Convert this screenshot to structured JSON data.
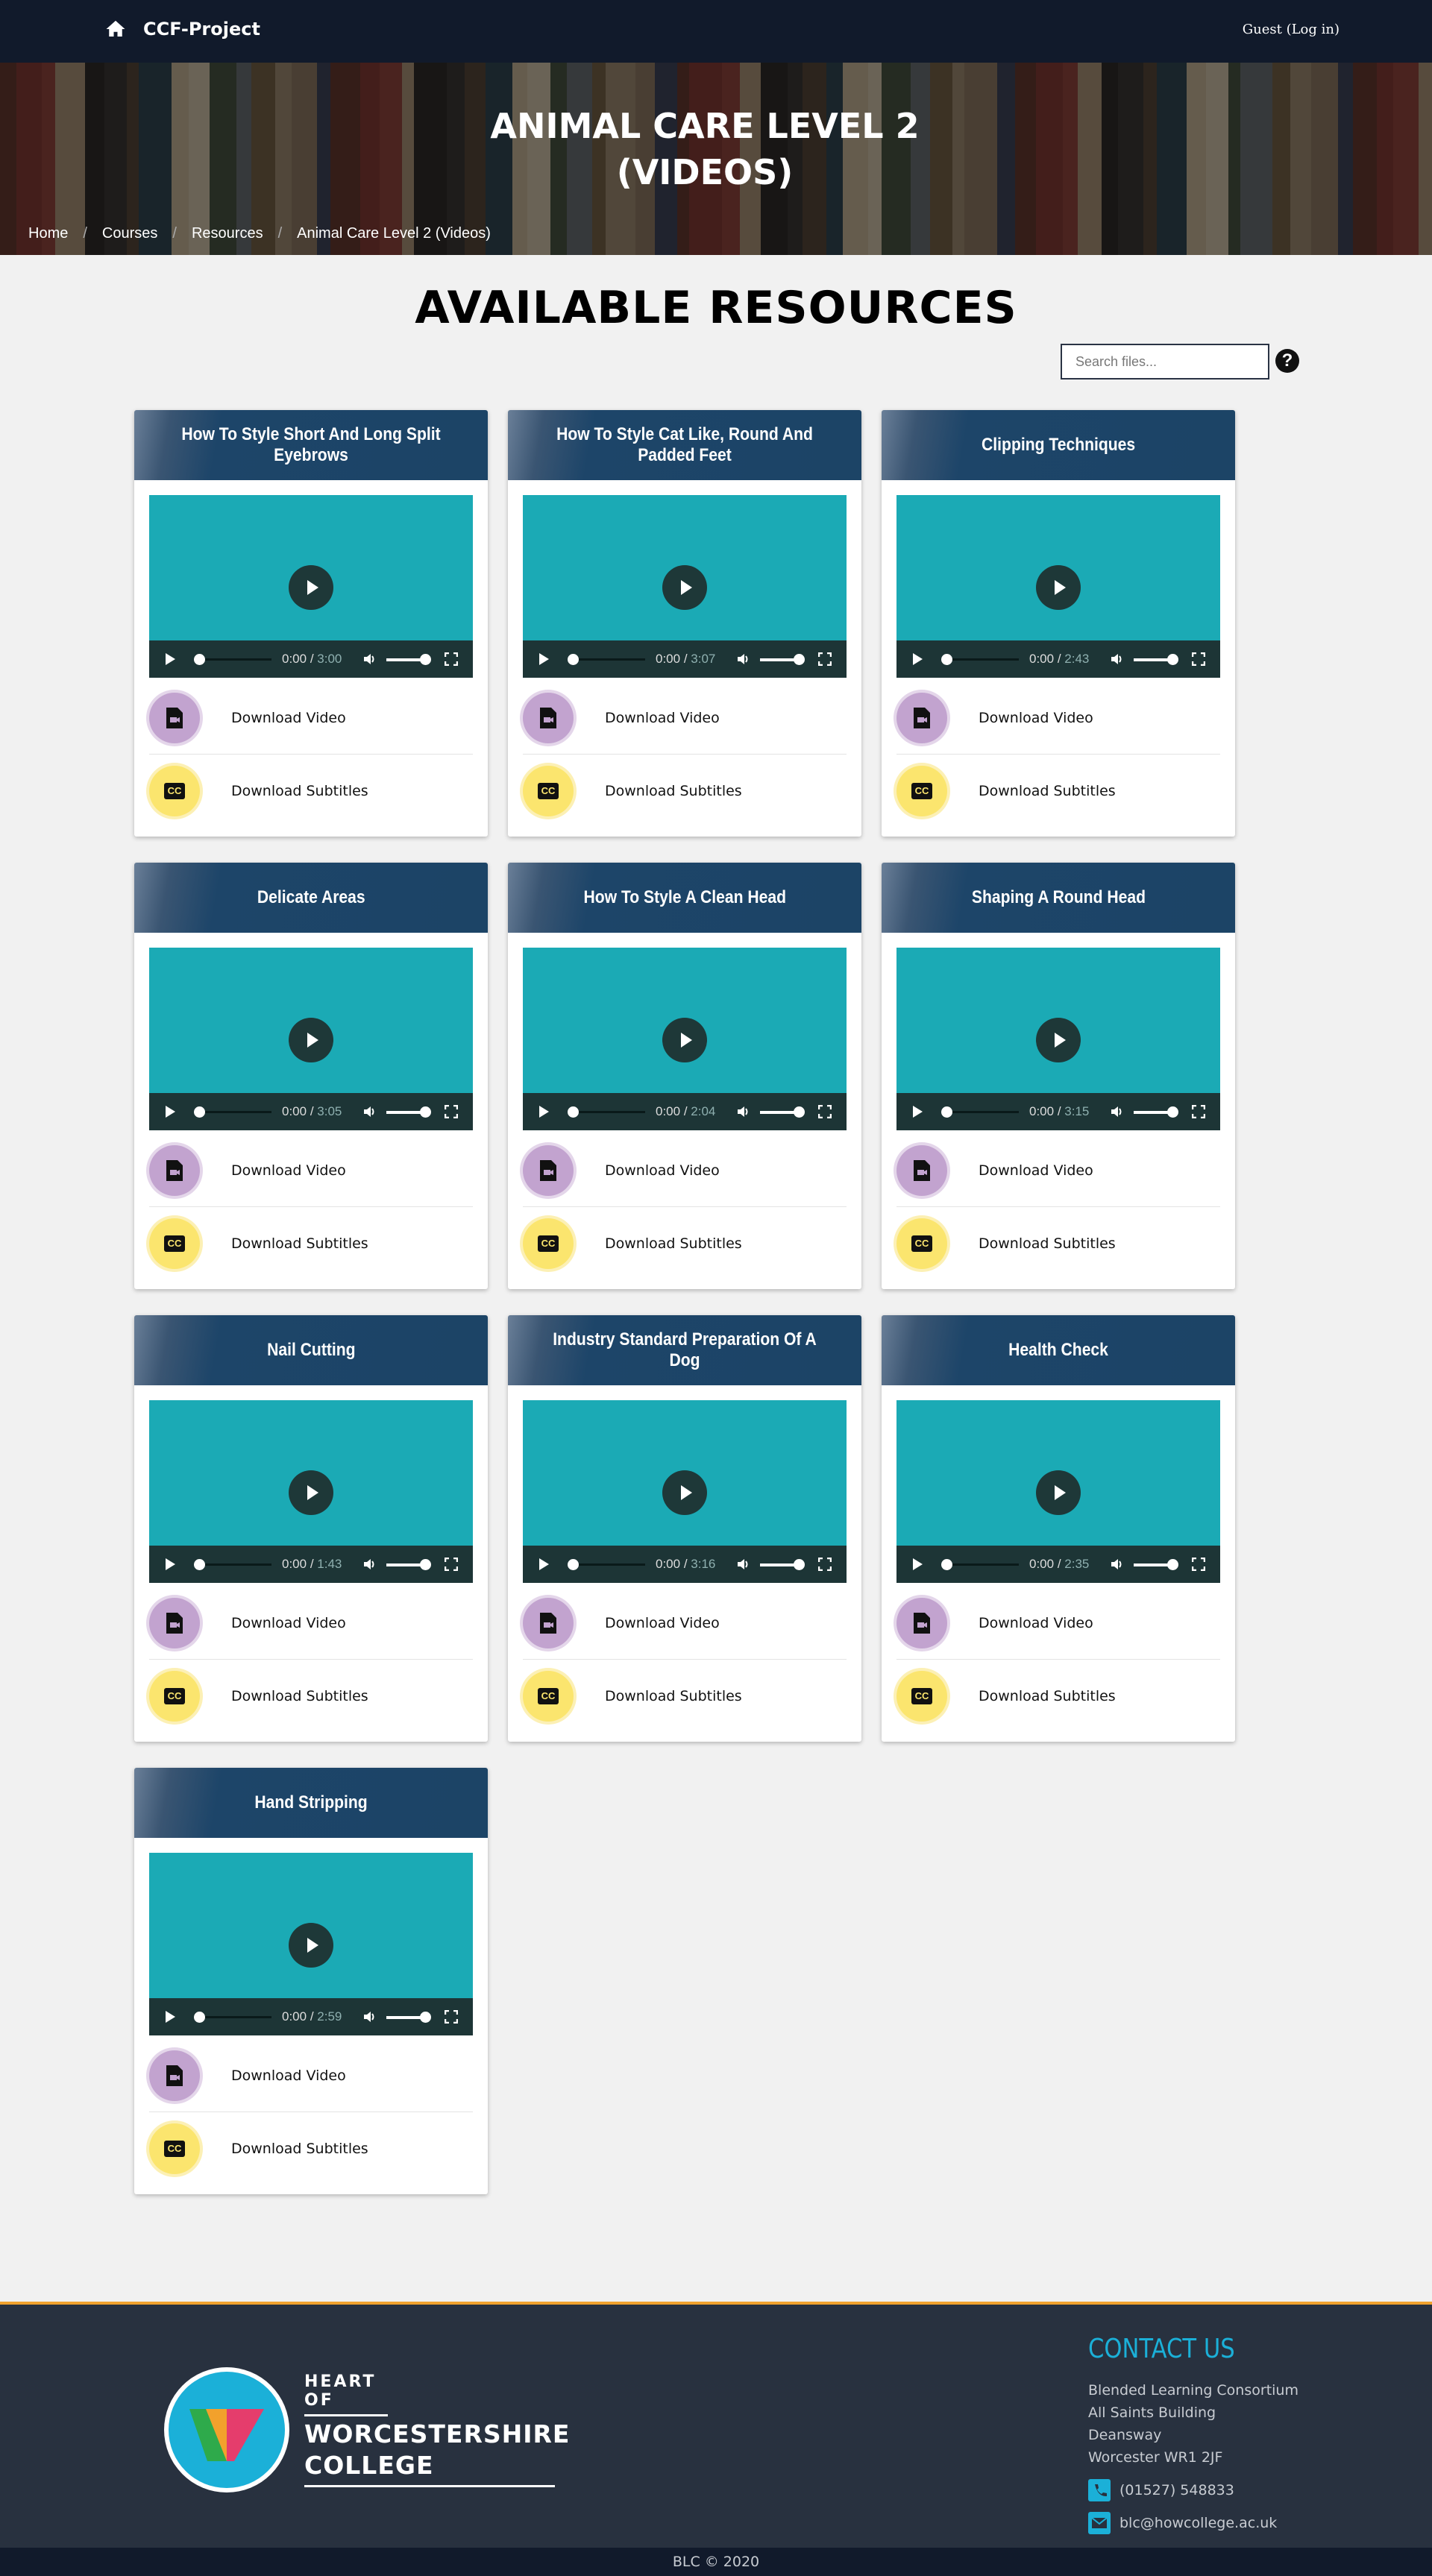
{
  "nav": {
    "brand": "CCF-Project",
    "login": "Guest (Log in)",
    "home_icon": "home-icon"
  },
  "hero": {
    "title_line1": "ANIMAL CARE LEVEL 2",
    "title_line2": "(VIDEOS)",
    "breadcrumb": [
      "Home",
      "Courses",
      "Resources",
      "Animal Care Level 2 (Videos)"
    ]
  },
  "main": {
    "heading": "AVAILABLE RESOURCES",
    "search_placeholder": "Search files...",
    "help_label": "?"
  },
  "labels": {
    "download_video": "Download Video",
    "download_subtitles": "Download Subtitles",
    "current_time": "0:00"
  },
  "cards": [
    {
      "title": "How To Style Short And Long Split Eyebrows",
      "duration": "3:00"
    },
    {
      "title": "How To Style Cat Like, Round And Padded Feet",
      "duration": "3:07"
    },
    {
      "title": "Clipping Techniques",
      "duration": "2:43"
    },
    {
      "title": "Delicate Areas",
      "duration": "3:05"
    },
    {
      "title": "How To Style A Clean Head",
      "duration": "2:04"
    },
    {
      "title": "Shaping A Round Head",
      "duration": "3:15"
    },
    {
      "title": "Nail Cutting",
      "duration": "1:43"
    },
    {
      "title": "Industry Standard Preparation Of A Dog",
      "duration": "3:16"
    },
    {
      "title": "Health Check",
      "duration": "2:35"
    },
    {
      "title": "Hand Stripping",
      "duration": "2:59"
    }
  ],
  "footer": {
    "logo_small": "HEART OF",
    "logo_big1": "WORCESTERSHIRE",
    "logo_big2": "COLLEGE",
    "contact_title": "CONTACT US",
    "address": [
      "Blended Learning Consortium",
      "All Saints Building",
      "Deansway",
      "Worcester WR1 2JF"
    ],
    "phone": "(01527) 548833",
    "email": "blc@howcollege.ac.uk",
    "copyright": "BLC © 2020"
  },
  "colors": {
    "nav_bg": "#111a2b",
    "card_header": "#1c4466",
    "player_bg": "#1baab5",
    "video_icon": "#c2a3cf",
    "subs_icon": "#fbe56e",
    "footer_bg": "#28313f",
    "footer_accent": "#f0a22e",
    "contact_title": "#1bb0d8"
  }
}
